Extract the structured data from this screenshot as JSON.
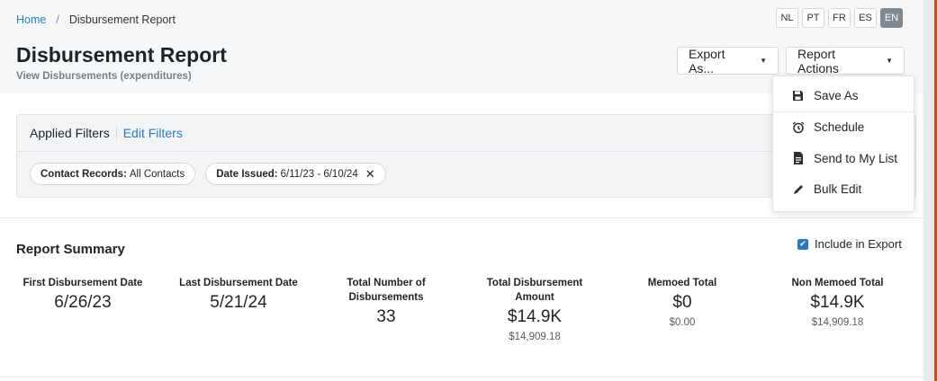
{
  "breadcrumb": {
    "home": "Home",
    "separator": "/",
    "current": "Disbursement Report"
  },
  "languages": [
    "NL",
    "PT",
    "FR",
    "ES",
    "EN"
  ],
  "active_language": "EN",
  "page": {
    "title": "Disbursement Report",
    "subtitle": "View Disbursements (expenditures)"
  },
  "buttons": {
    "export_label": "Export As...",
    "actions_label": "Report Actions",
    "caret": "▼"
  },
  "filters": {
    "title": "Applied Filters",
    "edit_label": "Edit Filters",
    "chips": [
      {
        "label": "Contact Records:",
        "value": "All Contacts",
        "removable": false
      },
      {
        "label": "Date Issued:",
        "value": "6/11/23 - 6/10/24",
        "removable": true
      }
    ],
    "remove_icon": "✕"
  },
  "summary": {
    "title": "Report Summary",
    "include_label": "Include in Export",
    "include_checked": true,
    "stats": [
      {
        "label": "First Disbursement Date",
        "value": "6/26/23",
        "sub": ""
      },
      {
        "label": "Last Disbursement Date",
        "value": "5/21/24",
        "sub": ""
      },
      {
        "label": "Total Number of Disbursements",
        "value": "33",
        "sub": ""
      },
      {
        "label": "Total Disbursement Amount",
        "value": "$14.9K",
        "sub": "$14,909.18"
      },
      {
        "label": "Memoed Total",
        "value": "$0",
        "sub": "$0.00"
      },
      {
        "label": "Non Memoed Total",
        "value": "$14.9K",
        "sub": "$14,909.18"
      }
    ]
  },
  "menu": {
    "items": [
      {
        "label": "Save As",
        "icon": "save-icon"
      },
      {
        "label": "Schedule",
        "icon": "alarm-clock-icon"
      },
      {
        "label": "Send to My List",
        "icon": "document-icon"
      },
      {
        "label": "Bulk Edit",
        "icon": "pencil-icon"
      }
    ]
  },
  "colors": {
    "link": "#2a7ac0",
    "active_lang_bg": "#808890",
    "checkbox": "#2a7ac0",
    "accent_strip": "#b6552a"
  }
}
